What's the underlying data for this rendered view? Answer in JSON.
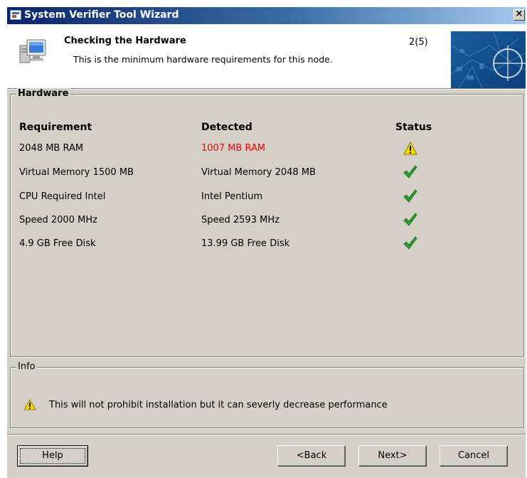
{
  "window": {
    "title": "System Verifier Tool Wizard",
    "close_label": "×"
  },
  "header": {
    "title": "Checking the Hardware",
    "subtitle": "This is the minimum hardware requirements for this node.",
    "step": "2(5)"
  },
  "hardware": {
    "group_label": "Hardware",
    "columns": [
      "Requirement",
      "Detected",
      "Status"
    ],
    "rows": [
      {
        "requirement": "2048 MB RAM",
        "detected": "1007 MB RAM",
        "status": "warning-icon"
      },
      {
        "requirement": "Virtual Memory 1500 MB",
        "detected": "Virtual Memory 2048 MB",
        "status": "checkmark-icon"
      },
      {
        "requirement": "CPU Required  Intel",
        "detected": "Intel Pentium",
        "status": "checkmark-icon"
      },
      {
        "requirement": "Speed 2000 MHz",
        "detected": "Speed 2593 MHz",
        "status": "checkmark-icon"
      },
      {
        "requirement": "4.9 GB Free Disk",
        "detected": "13.99 GB Free Disk",
        "status": "checkmark-icon"
      }
    ]
  },
  "info": {
    "group_label": "Info",
    "message": "This will not prohibit installation but it can severly decrease performance"
  },
  "buttons": {
    "help": "Help",
    "back": "<Back",
    "next": "Next>",
    "cancel": "Cancel"
  },
  "colors": {
    "title_bar_start": "#0a246a",
    "title_bar_end": "#a6caf0",
    "warning_text": "#ff0000",
    "check_green": "#2e9a2e",
    "warning_yellow": "#f5d800",
    "dialog_bg": "#d4d0c8"
  }
}
